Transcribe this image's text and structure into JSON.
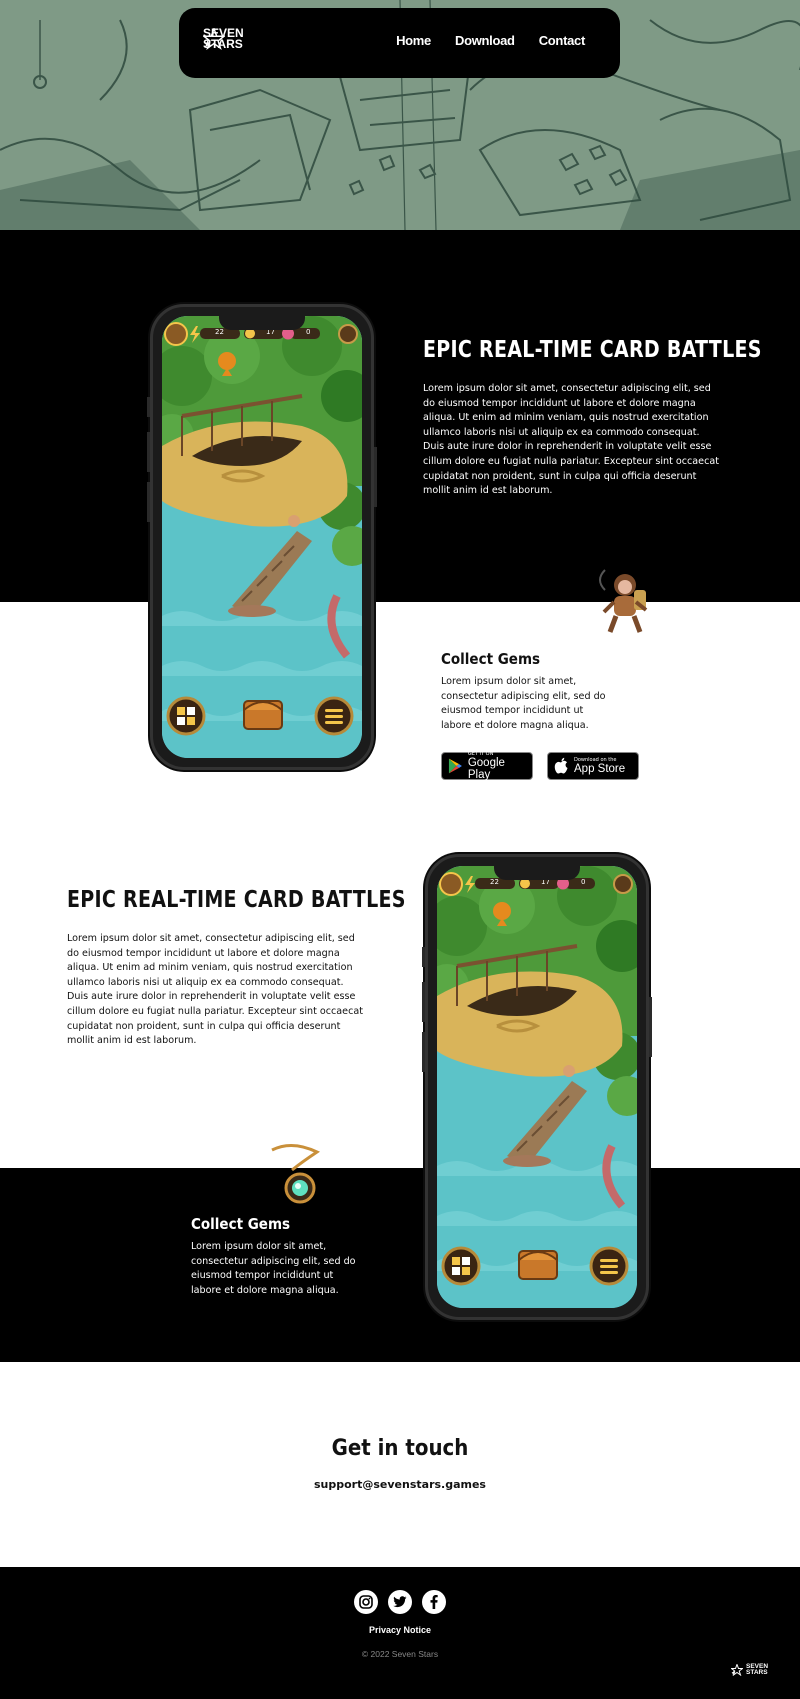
{
  "nav": {
    "logo_line1": "SEVEN",
    "logo_line2": "STARS",
    "links": [
      "Home",
      "Download",
      "Contact"
    ]
  },
  "section1": {
    "title": "EPIC REAL-TIME CARD BATTLES",
    "body": "Lorem ipsum dolor sit amet, consectetur adipiscing elit, sed do eiusmod tempor incididunt ut labore et dolore magna aliqua. Ut enim ad minim veniam, quis nostrud exercitation ullamco laboris nisi ut aliquip ex ea commodo consequat. Duis aute irure dolor in reprehenderit in voluptate velit esse cillum dolore eu fugiat nulla pariatur. Excepteur sint occaecat cupidatat non proident, sunt in culpa qui officia deserunt mollit anim id est laborum.",
    "sub_title": "Collect Gems",
    "sub_body": "Lorem ipsum dolor sit amet, consectetur adipiscing elit, sed do eiusmod tempor incididunt ut labore et dolore magna aliqua."
  },
  "stores": {
    "google_small": "GET IT ON",
    "google_big": "Google Play",
    "apple_small": "Download on the",
    "apple_big": "App Store"
  },
  "section2": {
    "title": "EPIC REAL-TIME CARD BATTLES",
    "body": "Lorem ipsum dolor sit amet, consectetur adipiscing elit, sed do eiusmod tempor incididunt ut labore et dolore magna aliqua. Ut enim ad minim veniam, quis nostrud exercitation ullamco laboris nisi ut aliquip ex ea commodo consequat. Duis aute irure dolor in reprehenderit in voluptate velit esse cillum dolore eu fugiat nulla pariatur. Excepteur sint occaecat cupidatat non proident, sunt in culpa qui officia deserunt mollit anim id est laborum.",
    "sub_title": "Collect Gems",
    "sub_body": "Lorem ipsum dolor sit amet, consectetur adipiscing elit, sed do eiusmod tempor incididunt ut labore et dolore magna aliqua."
  },
  "game_hud": {
    "energy": "22",
    "coins": "17",
    "gems": "0"
  },
  "contact": {
    "title": "Get in touch",
    "email": "support@sevenstars.games"
  },
  "footer": {
    "social": [
      "instagram-icon",
      "twitter-icon",
      "facebook-icon"
    ],
    "privacy": "Privacy Notice",
    "copyright": "© 2022 Seven Stars",
    "logo_line1": "SEVEN",
    "logo_line2": "STARS"
  },
  "colors": {
    "hero_tint": "#7f9a86",
    "black": "#000000",
    "white": "#ffffff",
    "water": "#5cc3c8",
    "foliage": "#4e9a3a",
    "sand": "#d9b45a"
  }
}
